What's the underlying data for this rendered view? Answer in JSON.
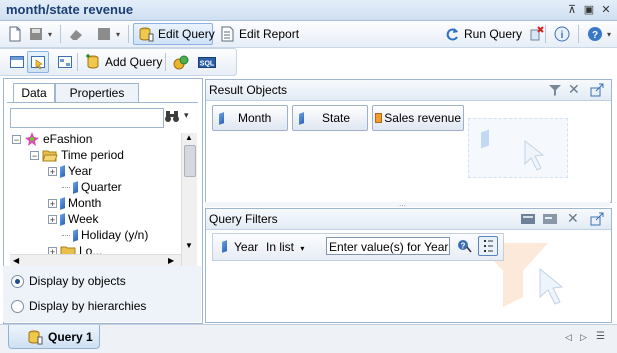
{
  "window": {
    "title": "month/state revenue"
  },
  "toolbar1": {
    "edit_query_label": "Edit Query",
    "edit_report_label": "Edit Report",
    "run_query_label": "Run Query"
  },
  "toolbar2": {
    "add_query_label": "Add Query",
    "sql_label": "SQL"
  },
  "left_panel": {
    "tabs": [
      {
        "label": "Data"
      },
      {
        "label": "Properties"
      }
    ],
    "search": {
      "value": "",
      "placeholder": ""
    },
    "tree": {
      "root": "eFashion",
      "folder": "Time period",
      "items": [
        {
          "label": "Year"
        },
        {
          "label": "Quarter"
        },
        {
          "label": "Month"
        },
        {
          "label": "Week"
        },
        {
          "label": "Holiday (y/n)"
        },
        {
          "label": "Lo..."
        }
      ]
    },
    "display_options": [
      {
        "label": "Display by objects",
        "selected": true
      },
      {
        "label": "Display by hierarchies",
        "selected": false
      }
    ]
  },
  "result_objects": {
    "title": "Result Objects",
    "items": [
      {
        "label": "Month",
        "icon": "dimension-icon"
      },
      {
        "label": "State",
        "icon": "dimension-icon"
      },
      {
        "label": "Sales revenue",
        "icon": "measure-icon"
      }
    ]
  },
  "query_filters": {
    "title": "Query Filters",
    "filter": {
      "object": "Year",
      "operator": "In list",
      "value_text": "Enter value(s) for Year:"
    }
  },
  "bottom_tabs": [
    {
      "label": "Query 1"
    }
  ],
  "colors": {
    "title_text": "#1b3f73",
    "panel_border": "#9fb6d0",
    "header_bg": "#e2ebf5"
  }
}
